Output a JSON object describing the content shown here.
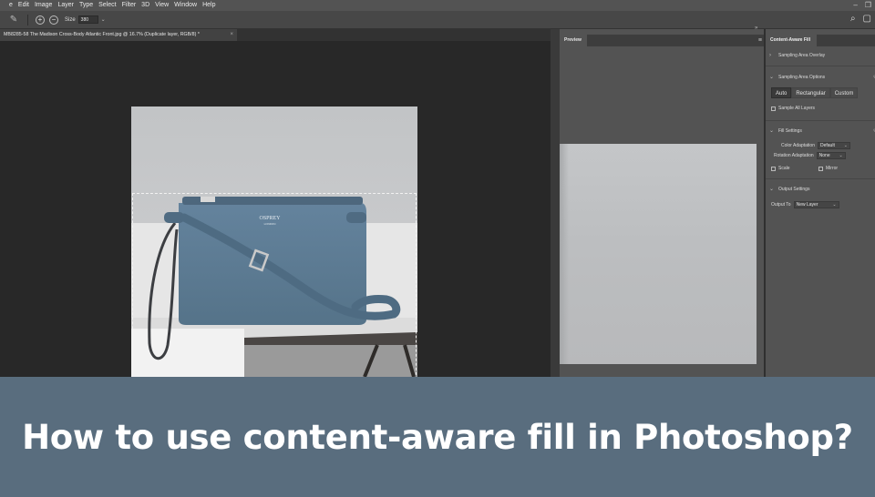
{
  "menubar": {
    "items": [
      "e",
      "Edit",
      "Image",
      "Layer",
      "Type",
      "Select",
      "Filter",
      "3D",
      "View",
      "Window",
      "Help"
    ],
    "window_controls": [
      "–",
      "❐"
    ]
  },
  "options_bar": {
    "size_label": "Size",
    "size_value": "380",
    "add_glyph": "+",
    "subtract_glyph": "−",
    "caret": "⌄",
    "search_icon_glyph": "⌕",
    "workspace_icon_glyph": "▢",
    "tool_glyph": "✎"
  },
  "document": {
    "tab_title": "MB8285-58 The Madison Cross-Body Atlantic Front.jpg @ 16.7% (Duplicate layer, RGB/8) *",
    "close_glyph": "×",
    "bag_brand": "OSPREY",
    "bag_subbrand": "LONDON"
  },
  "preview_panel": {
    "tab_label": "Preview",
    "menu_glyph": "≡",
    "collapse_glyph": "»"
  },
  "caf_panel": {
    "tab_label": "Content-Aware Fill",
    "sampling_overlay": "Sampling Area Overlay",
    "sampling_options": "Sampling Area Options",
    "modes": [
      "Auto",
      "Rectangular",
      "Custom"
    ],
    "sample_all_layers": "Sample All Layers",
    "fill_settings": "Fill Settings",
    "color_adaptation_label": "Color Adaptation",
    "color_adaptation_value": "Default",
    "rotation_adaptation_label": "Rotation Adaptation",
    "rotation_adaptation_value": "None",
    "scale_label": "Scale",
    "mirror_label": "Mirror",
    "output_settings": "Output Settings",
    "output_to_label": "Output To",
    "output_to_value": "New Layer",
    "chevron_right": "›",
    "chevron_down": "⌄",
    "reset_glyph": "↺"
  },
  "caption": {
    "title": "How to use content-aware fill in Photoshop?"
  },
  "colors": {
    "banner": "#596d7e",
    "panel": "#535353",
    "canvas_bg": "#282828",
    "bag": "#5b7a94"
  }
}
